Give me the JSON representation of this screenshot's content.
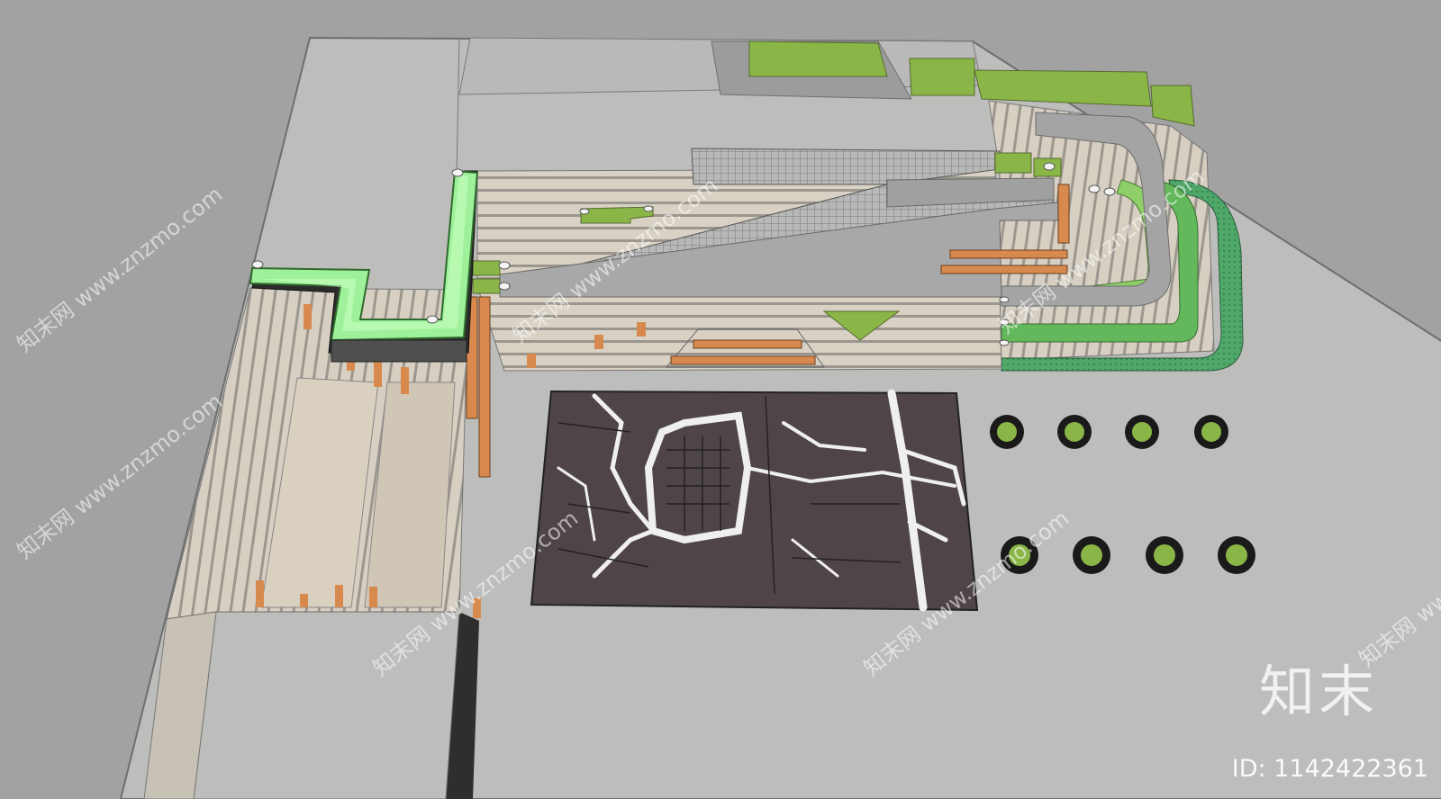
{
  "watermark": {
    "brand": "知末",
    "id_text": "ID: 1142422361",
    "tile_text": "知末网 www.znzmo.com"
  },
  "colors": {
    "background": "#a2a2a2",
    "paving": "#bdbdbb",
    "paving_dark": "#9d9d9d",
    "stripe_light": "#d7d0c3",
    "grass": "#8ab648",
    "bright_green": "#9ef09a",
    "bench_orange": "#d88a4e",
    "map_dark": "#4f4548",
    "teal_green": "#3c9a60"
  }
}
